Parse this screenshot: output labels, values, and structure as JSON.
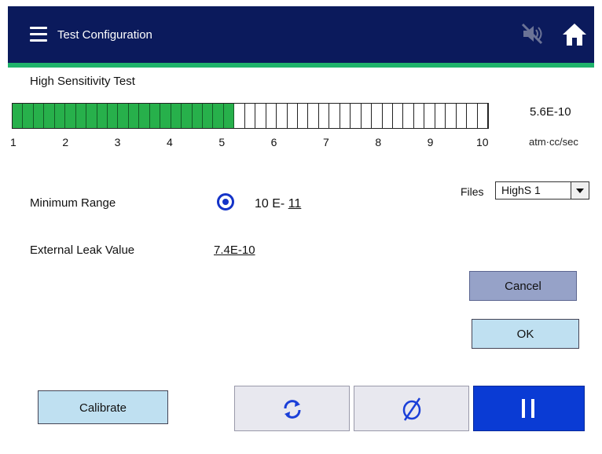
{
  "header": {
    "title": "Test Configuration",
    "icons": {
      "menu": "hamburger-menu-icon",
      "mute": "speaker-muted-icon",
      "home": "home-icon"
    },
    "colors": {
      "background": "#0b1a5c",
      "accent": "#1fb36b"
    }
  },
  "test": {
    "name": "High Sensitivity Test"
  },
  "bar": {
    "segments_total": 45,
    "segments_filled": 21,
    "fill_color": "#27b04b",
    "scale_labels": [
      "1",
      "2",
      "3",
      "4",
      "5",
      "6",
      "7",
      "8",
      "9",
      "10"
    ],
    "reading": "5.6E-10",
    "unit": "atm·cc/sec"
  },
  "minimum_range": {
    "label": "Minimum Range",
    "prefix": "10 E-",
    "exponent": "11",
    "selected": true
  },
  "external_leak": {
    "label": "External Leak Value",
    "value": "7.4E-10"
  },
  "files": {
    "label": "Files",
    "selected": "HighS 1"
  },
  "buttons": {
    "cancel": "Cancel",
    "ok": "OK",
    "calibrate": "Calibrate",
    "refresh_icon": "refresh-icon",
    "null_icon": "null-symbol-icon",
    "pause_icon": "pause-icon"
  }
}
